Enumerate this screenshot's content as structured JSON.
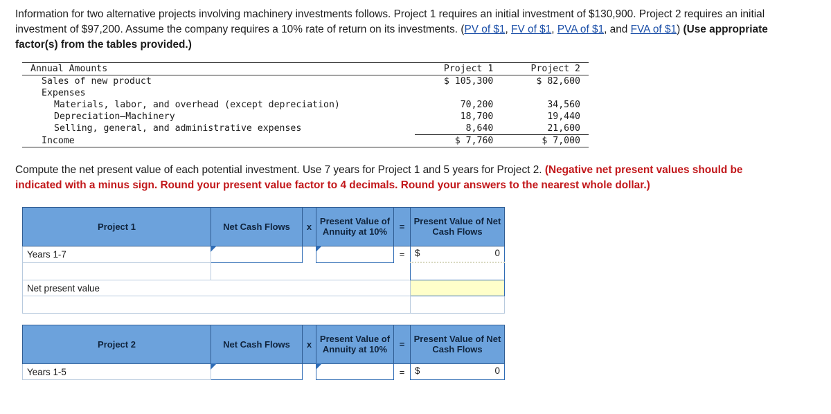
{
  "intro": {
    "line1": "Information for two alternative projects involving machinery investments follows. Project 1 requires an initial investment of $130,900.",
    "line2_pre": "Project 2 requires an initial investment of $97,200. Assume the company requires a 10% rate of return on its investments. (",
    "link1": "PV of $1",
    "link2": "FV of $1",
    "link3": "PVA of $1",
    "link4": "FVA of $1",
    "mid_comma": ", ",
    "and_text": ", and ",
    "close_paren": ") ",
    "bold_tail": "(Use appropriate factor(s) from the tables provided.)"
  },
  "annual_table": {
    "col_headers": [
      "Annual Amounts",
      "Project 1",
      "Project 2"
    ],
    "rows": [
      {
        "label": "Sales of new product",
        "indent": 1,
        "p1": "$ 105,300",
        "p2": "$ 82,600"
      },
      {
        "label": "Expenses",
        "indent": 1,
        "p1": "",
        "p2": ""
      },
      {
        "label": "Materials, labor, and overhead (except depreciation)",
        "indent": 2,
        "p1": "70,200",
        "p2": "34,560"
      },
      {
        "label": "Depreciation–Machinery",
        "indent": 2,
        "p1": "18,700",
        "p2": "19,440"
      },
      {
        "label": "Selling, general, and administrative expenses",
        "indent": 2,
        "p1": "8,640",
        "p2": "21,600"
      },
      {
        "label": "Income",
        "indent": 1,
        "p1": "$ 7,760",
        "p2": "$ 7,000"
      }
    ]
  },
  "compute": {
    "text_black": "Compute the net present value of each potential investment. Use 7 years for Project 1 and 5 years for Project 2. ",
    "text_red": "(Negative net present values should be indicated with a minus sign. Round your present value factor to 4 decimals. Round your answers to the nearest whole dollar.)"
  },
  "worksheet": {
    "project1": {
      "title": "Project 1",
      "col_net_cash_flows": "Net Cash Flows",
      "op_multiply": "x",
      "col_pv_annuity": "Present Value of Annuity at 10%",
      "op_equals": "=",
      "col_pv_net_cash": "Present Value of Net Cash Flows",
      "row_years_label": "Years 1-7",
      "row_years_net_cash": "",
      "row_years_factor": "",
      "row_years_eq": "=",
      "row_years_dollar": "$",
      "row_years_result": "0",
      "npv_label": "Net present value",
      "npv_value": ""
    },
    "project2": {
      "title": "Project 2",
      "col_net_cash_flows": "Net Cash Flows",
      "op_multiply": "x",
      "col_pv_annuity": "Present Value of Annuity at 10%",
      "op_equals": "=",
      "col_pv_net_cash": "Present Value of Net Cash Flows",
      "row_years_label": "Years 1-5",
      "row_years_net_cash": "",
      "row_years_factor": "",
      "row_years_eq": "=",
      "row_years_dollar": "$",
      "row_years_result": "0"
    }
  },
  "colors": {
    "header_blue": "#6ca2dc",
    "input_border": "#2f6cb5",
    "npv_yellow": "#ffffca",
    "link_blue": "#1b4fa8",
    "red_bold": "#c2181b"
  }
}
